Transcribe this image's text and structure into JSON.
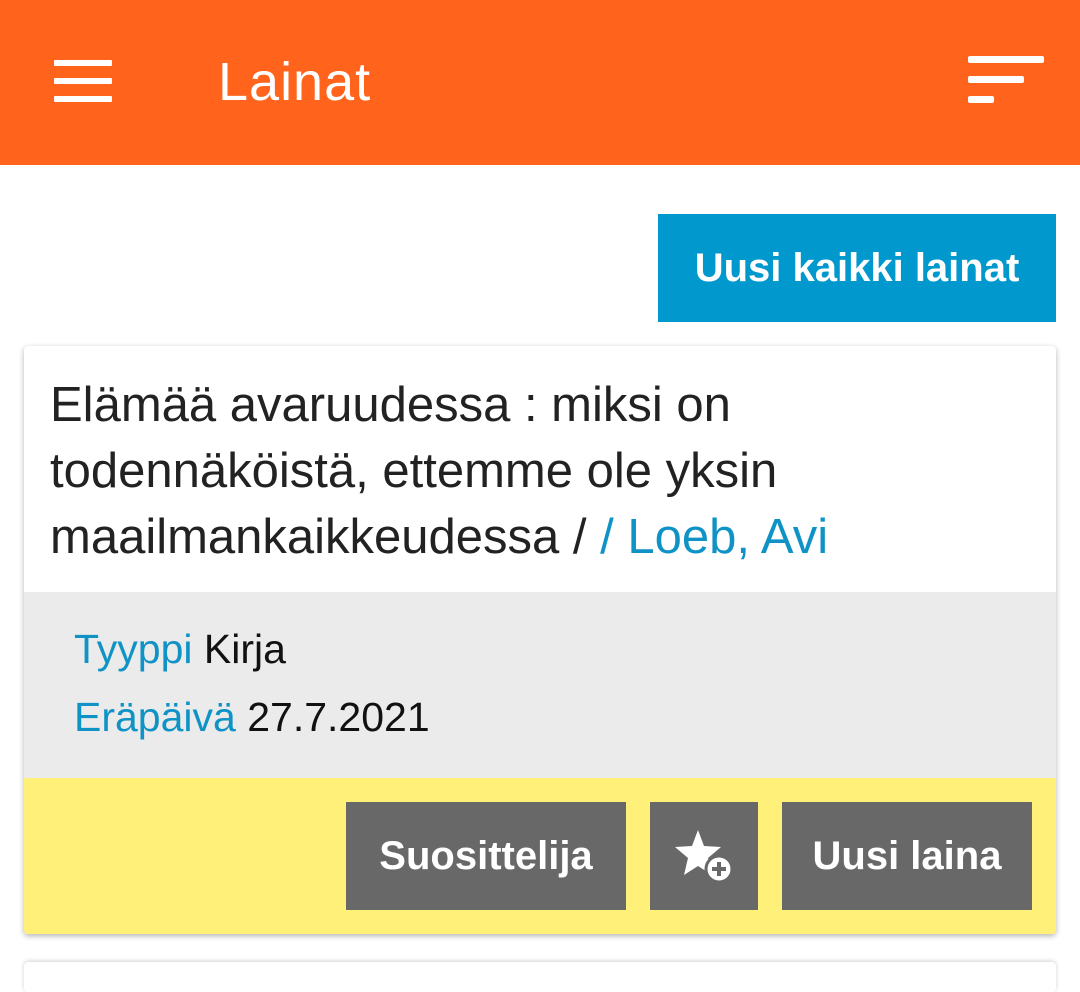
{
  "header": {
    "title": "Lainat",
    "menu_icon": "hamburger-menu-icon",
    "sort_icon": "sort-icon",
    "background": "#ff631c"
  },
  "renew_all_button": {
    "label": "Uusi kaikki lainat",
    "color": "#0199cd"
  },
  "loans": [
    {
      "title": "Elämää avaruudessa : miksi on todennäköistä, ettemme ole yksin maailmankaikkeudessa /",
      "author": "/ Loeb, Avi",
      "type_label": "Tyyppi",
      "type_value": "Kirja",
      "due_label": "Eräpäivä",
      "due_value": "27.7.2021",
      "actions": {
        "recommend_label": "Suosittelija",
        "favorite_icon": "star-add-icon",
        "renew_label": "Uusi laina"
      }
    }
  ],
  "colors": {
    "link_blue": "#0f93c6",
    "details_bg": "#ebebeb",
    "actions_bg": "#fff07a",
    "action_button": "#686868"
  }
}
